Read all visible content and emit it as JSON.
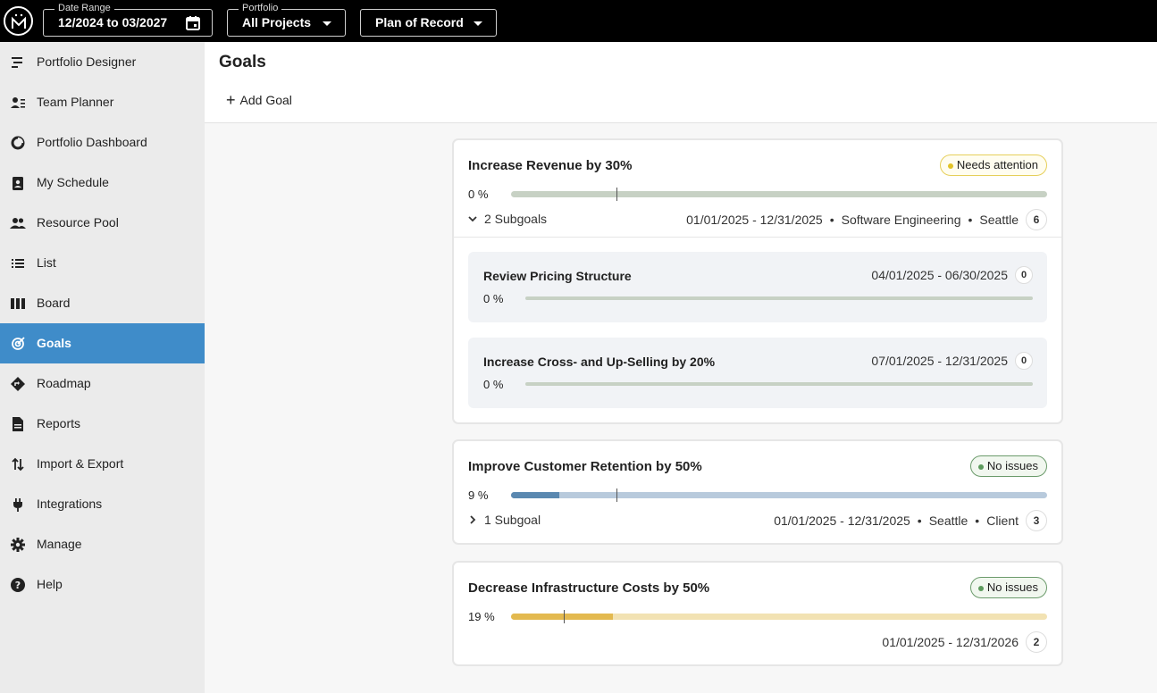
{
  "topbar": {
    "logo_text": "M",
    "date_range": {
      "label": "Date Range",
      "value": "12/2024 to 03/2027"
    },
    "portfolio": {
      "label": "Portfolio",
      "value": "All Projects"
    },
    "plan": {
      "value": "Plan of Record"
    }
  },
  "sidebar": {
    "items": [
      {
        "label": "Portfolio Designer",
        "icon": "portfolio-designer-icon"
      },
      {
        "label": "Team Planner",
        "icon": "team-planner-icon"
      },
      {
        "label": "Portfolio Dashboard",
        "icon": "dashboard-icon"
      },
      {
        "label": "My Schedule",
        "icon": "schedule-icon"
      },
      {
        "label": "Resource Pool",
        "icon": "resource-pool-icon"
      },
      {
        "label": "List",
        "icon": "list-icon"
      },
      {
        "label": "Board",
        "icon": "board-icon"
      },
      {
        "label": "Goals",
        "icon": "goals-icon",
        "active": true
      },
      {
        "label": "Roadmap",
        "icon": "roadmap-icon"
      },
      {
        "label": "Reports",
        "icon": "reports-icon"
      },
      {
        "label": "Import & Export",
        "icon": "import-export-icon"
      },
      {
        "label": "Integrations",
        "icon": "integrations-icon"
      },
      {
        "label": "Manage",
        "icon": "gear-icon"
      },
      {
        "label": "Help",
        "icon": "help-icon"
      }
    ],
    "active_color": "#3f8cc9"
  },
  "main": {
    "title": "Goals",
    "add_goal": "Add Goal"
  },
  "goals": [
    {
      "title": "Increase Revenue by 30%",
      "status": "Needs attention",
      "percent_text": "0 %",
      "progress": 0,
      "subgoals_label": "2 Subgoals",
      "dates": "01/01/2025 - 12/31/2025",
      "team": "Software Engineering",
      "location": "Seattle",
      "count": "6",
      "subgoals": [
        {
          "title": "Review Pricing Structure",
          "dates": "04/01/2025 - 06/30/2025",
          "count": "0",
          "percent_text": "0 %"
        },
        {
          "title": "Increase Cross- and Up-Selling by 20%",
          "dates": "07/01/2025 - 12/31/2025",
          "count": "0",
          "percent_text": "0 %"
        }
      ]
    },
    {
      "title": "Improve Customer Retention by 50%",
      "status": "No issues",
      "percent_text": "9 %",
      "progress": 0.09,
      "subgoals_label": "1 Subgoal",
      "dates": "01/01/2025 - 12/31/2025",
      "location": "Seattle",
      "client": "Client",
      "count": "3"
    },
    {
      "title": "Decrease Infrastructure Costs by 50%",
      "status": "No issues",
      "percent_text": "19 %",
      "progress": 0.19,
      "dates": "01/01/2025 - 12/31/2026",
      "count": "2"
    }
  ],
  "colors": {
    "bar_grey": "#c7d1c4",
    "bar_blue_track": "#b8cadc",
    "bar_blue_fill": "#5a88b0",
    "bar_gold_track": "#f2e2b3",
    "bar_gold_fill": "#e3b94f"
  }
}
